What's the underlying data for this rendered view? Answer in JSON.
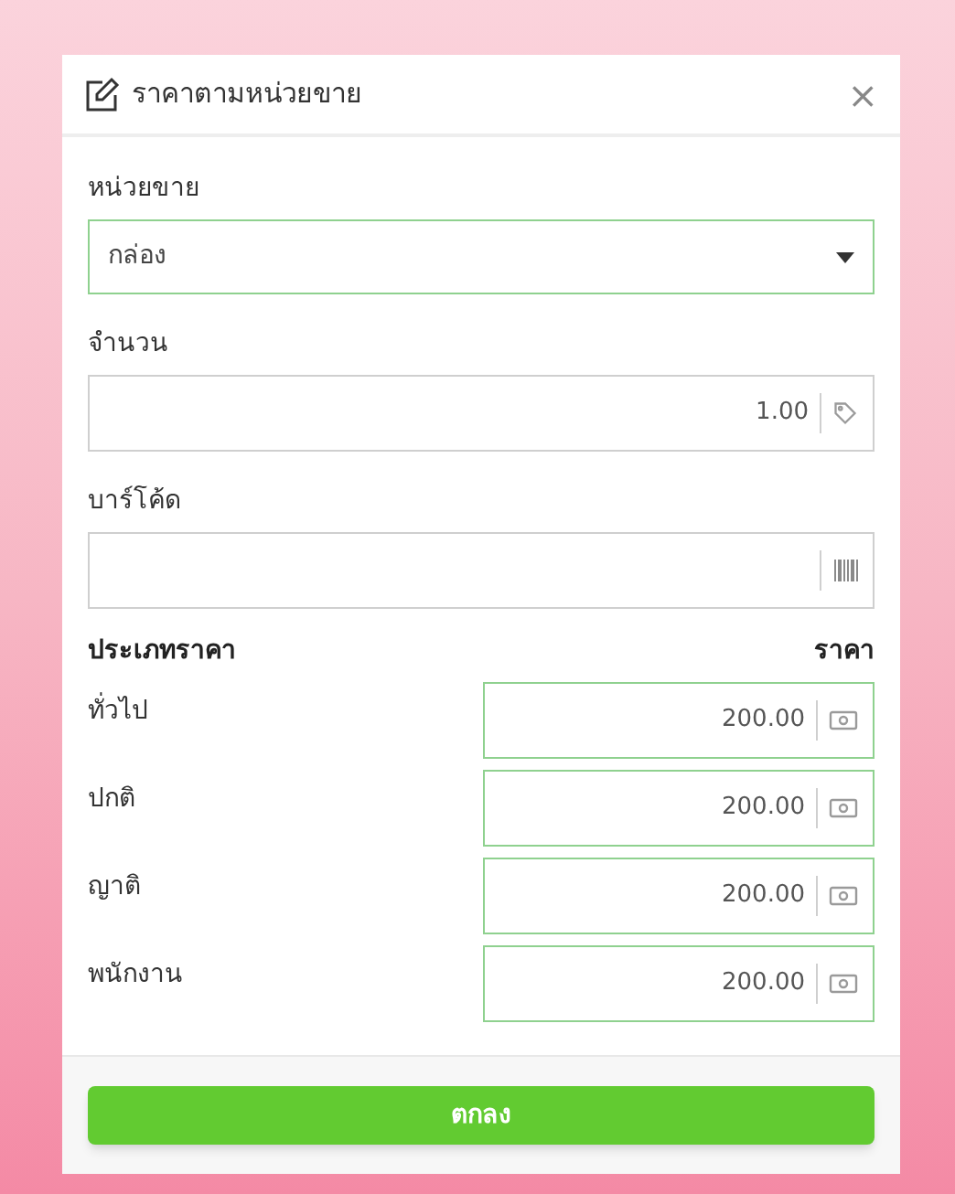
{
  "dialog": {
    "title": "ราคาตามหน่วยขาย",
    "close": "×"
  },
  "unit": {
    "label": "หน่วยขาย",
    "value": "กล่อง",
    "valid": true
  },
  "quantity": {
    "label": "จำนวน",
    "value": "1.00",
    "valid": false
  },
  "barcode": {
    "label": "บาร์โค้ด",
    "valid": false
  },
  "prices": {
    "column_1": "ประเภทราคา",
    "column_2": "ราคา",
    "rows": [
      {
        "name": "ทั่วไป",
        "value": "200.00",
        "valid": true
      },
      {
        "name": "ปกติ",
        "value": "200.00",
        "valid": true
      },
      {
        "name": "ญาติ",
        "value": "200.00",
        "valid": true
      },
      {
        "name": "พนักงาน",
        "value": "200.00",
        "valid": true
      }
    ]
  },
  "ok_button": "ตกลง"
}
